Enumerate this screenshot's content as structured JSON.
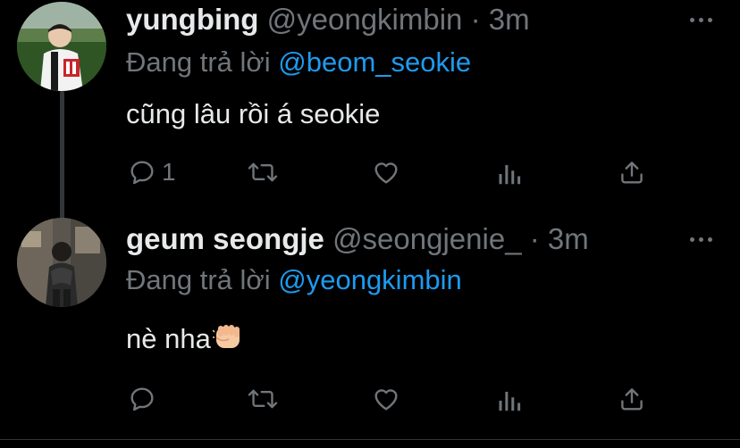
{
  "tweets": [
    {
      "display_name": "yungbing",
      "handle": "@yeongkimbin",
      "separator": "·",
      "time": "3m",
      "reply_prefix": "Đang trả lời",
      "reply_to": "@beom_seokie",
      "text": "cũng lâu rồi á seokie",
      "reply_count": "1",
      "avatar_icon": "avatar-photo-baseball-fan",
      "colors": {
        "name": "#e7e9ea",
        "muted": "#71767b",
        "mention": "#1d9bf0"
      }
    },
    {
      "display_name": "geum seongje",
      "handle": "@seongjenie_",
      "separator": "·",
      "time": "3m",
      "reply_prefix": "Đang trả lời",
      "reply_to": "@yeongkimbin",
      "text": "nè nha",
      "emoji": "fist-bump-emoji",
      "reply_count": "",
      "avatar_icon": "avatar-photo-street",
      "colors": {
        "name": "#e7e9ea",
        "muted": "#71767b",
        "mention": "#1d9bf0"
      }
    }
  ],
  "action_icons": [
    "reply-icon",
    "retweet-icon",
    "like-icon",
    "analytics-icon",
    "share-icon"
  ],
  "theme": {
    "background": "#000000",
    "thread_line": "#333639"
  }
}
